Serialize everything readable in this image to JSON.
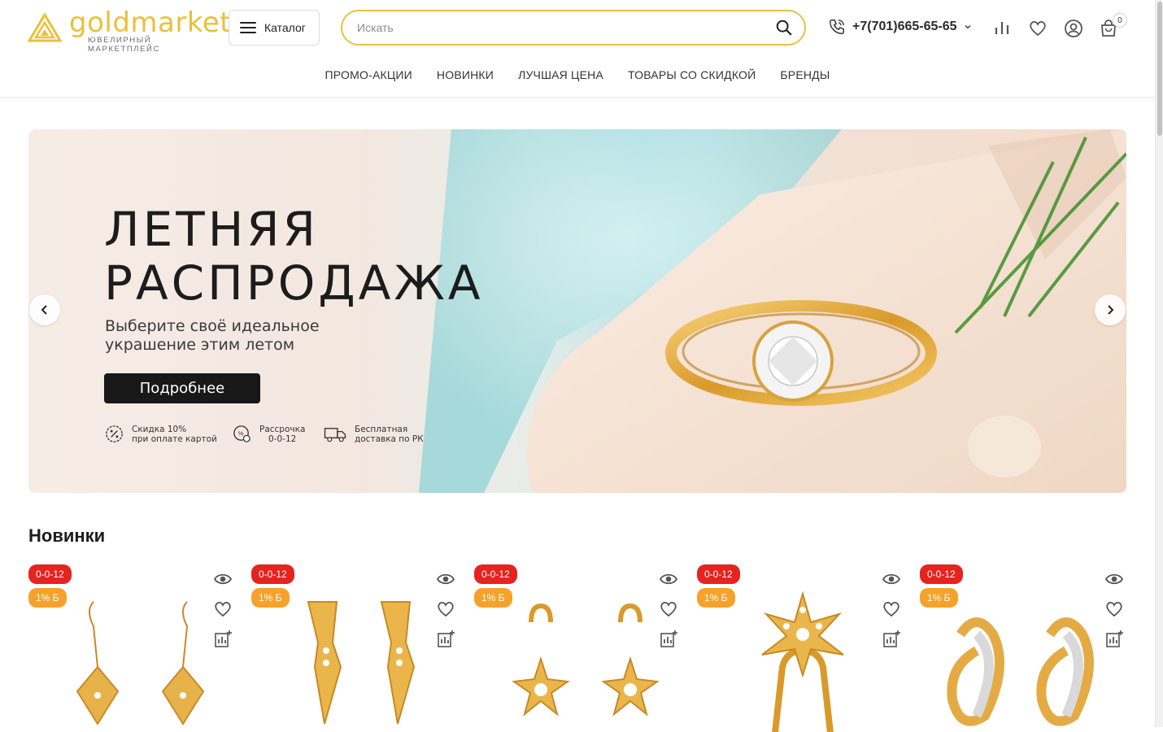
{
  "brand": {
    "name": "goldmarket",
    "tagline": "ЮВЕЛИРНЫЙ МАРКЕТПЛЕЙС",
    "accent": "#e9c13a"
  },
  "header": {
    "catalog_label": "Каталог",
    "search_placeholder": "Искать",
    "phone": "+7(701)665-65-65",
    "cart_count": "0",
    "icons": [
      "phone-icon",
      "compare-icon",
      "heart-icon",
      "user-icon",
      "cart-icon"
    ]
  },
  "nav": {
    "items": [
      "ПРОМО-АКЦИИ",
      "НОВИНКИ",
      "ЛУЧШАЯ ЦЕНА",
      "ТОВАРЫ СО СКИДКОЙ",
      "БРЕНДЫ"
    ]
  },
  "banner": {
    "title_line1": "ЛЕТНЯЯ",
    "title_line2": "РАСПРОДАЖА",
    "subtitle": "Выберите своё идеальное украшение этим летом",
    "button": "Подробнее",
    "features": [
      {
        "line1": "Скидка 10%",
        "line2": "при оплате картой",
        "icon": "discount-icon"
      },
      {
        "line1": "Рассрочка",
        "line2": "0-0-12",
        "icon": "installment-icon"
      },
      {
        "line1": "Бесплатная",
        "line2": "доставка по РК",
        "icon": "truck-icon"
      }
    ]
  },
  "products": {
    "section_title": "Новинки",
    "items": [
      {
        "tag_installment": "0-0-12",
        "tag_bonus": "1% Б",
        "kind": "earrings"
      },
      {
        "tag_installment": "0-0-12",
        "tag_bonus": "1% Б",
        "kind": "earrings"
      },
      {
        "tag_installment": "0-0-12",
        "tag_bonus": "1% Б",
        "kind": "earrings"
      },
      {
        "tag_installment": "0-0-12",
        "tag_bonus": "1% Б",
        "kind": "ring"
      },
      {
        "tag_installment": "0-0-12",
        "tag_bonus": "1% Б",
        "kind": "earrings"
      }
    ],
    "tag_colors": {
      "installment": "#e5231f",
      "bonus": "#f6a22a"
    }
  }
}
